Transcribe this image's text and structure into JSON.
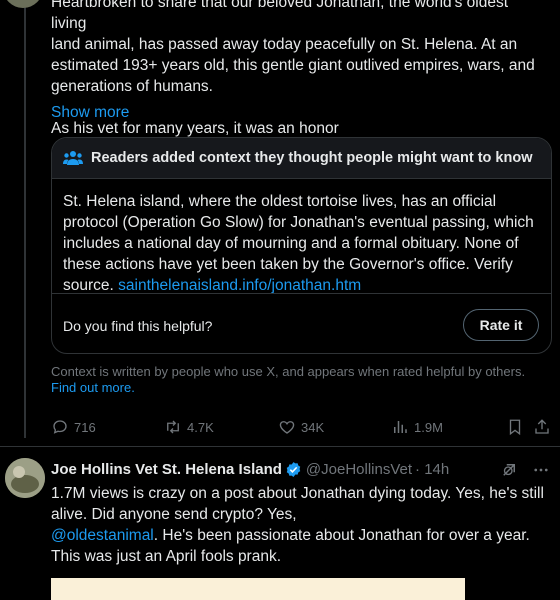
{
  "post": {
    "text_lines": [
      "Heartbroken to share that our beloved Jonathan, the world's oldest living",
      "land animal, has passed away today peacefully on St. Helena. At an",
      "estimated 193+ years old, this gentle giant outlived empires, wars, and",
      "generations of humans."
    ],
    "text_line_last": "As his vet for many years, it was an honor",
    "show_more": "Show more"
  },
  "community_note": {
    "header": "Readers added context they thought people might want to know",
    "body": "St. Helena island, where the oldest tortoise lives, has an official protocol (Operation Go Slow) for Jonathan's eventual passing, which includes a national day of mourning and a formal obituary. None of these actions have yet been taken by the Governor's office. Verify source.",
    "link": "sainthelenaisland.info/jonathan.htm",
    "question": "Do you find this helpful?",
    "rate_button": "Rate it"
  },
  "context_notice": {
    "text": "Context is written by people who use X, and appears when rated helpful by others.",
    "link": "Find out more."
  },
  "actions": {
    "replies": "716",
    "reposts": "4.7K",
    "likes": "34K",
    "views": "1.9M"
  },
  "reply": {
    "name": "Joe Hollins Vet St. Helena Island",
    "handle": "@JoeHollinsVet",
    "time": "· 14h",
    "text_before_mention": "1.7M views is crazy on a post about Jonathan dying today. Yes, he's still alive. Did anyone send crypto? Yes,",
    "mention": "@oldestanimal",
    "text_after_mention": ". He's been passionate about Jonathan for over a year. This was just an April fools prank."
  },
  "colors": {
    "background": "#000000",
    "text": "#e7e9ea",
    "secondary": "#71767b",
    "link": "#1d9bf0",
    "border": "#2f3336"
  }
}
